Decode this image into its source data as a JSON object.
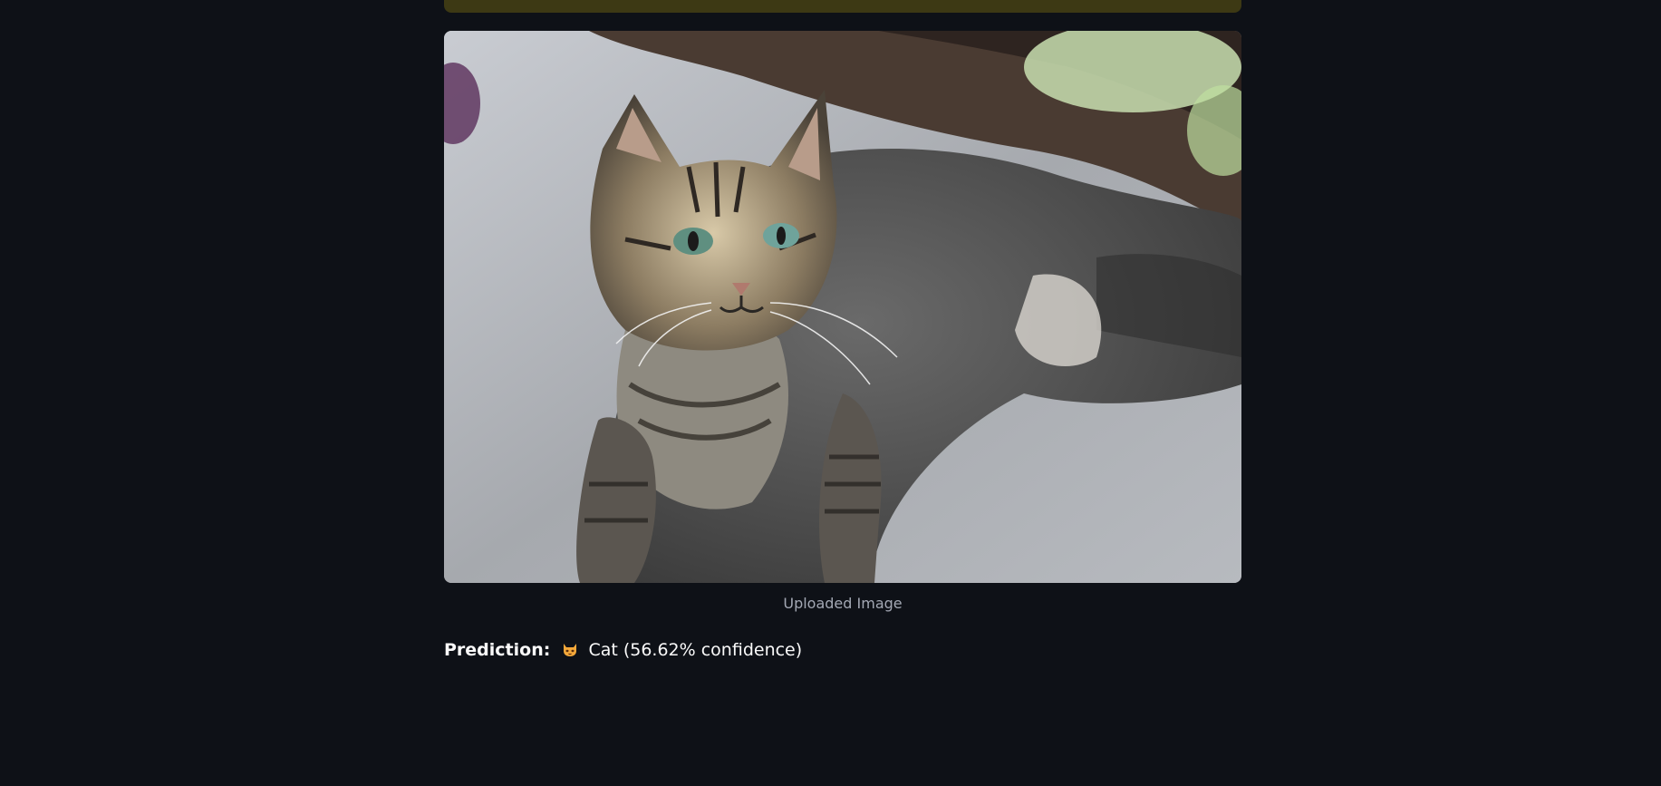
{
  "alert": {
    "color": "#3d3914"
  },
  "image": {
    "caption": "Uploaded Image",
    "subject": "tabby-cat-photo"
  },
  "prediction": {
    "label": "Prediction:",
    "emoji_icon": "cat-face-icon",
    "text": "Cat (56.62% confidence)"
  }
}
